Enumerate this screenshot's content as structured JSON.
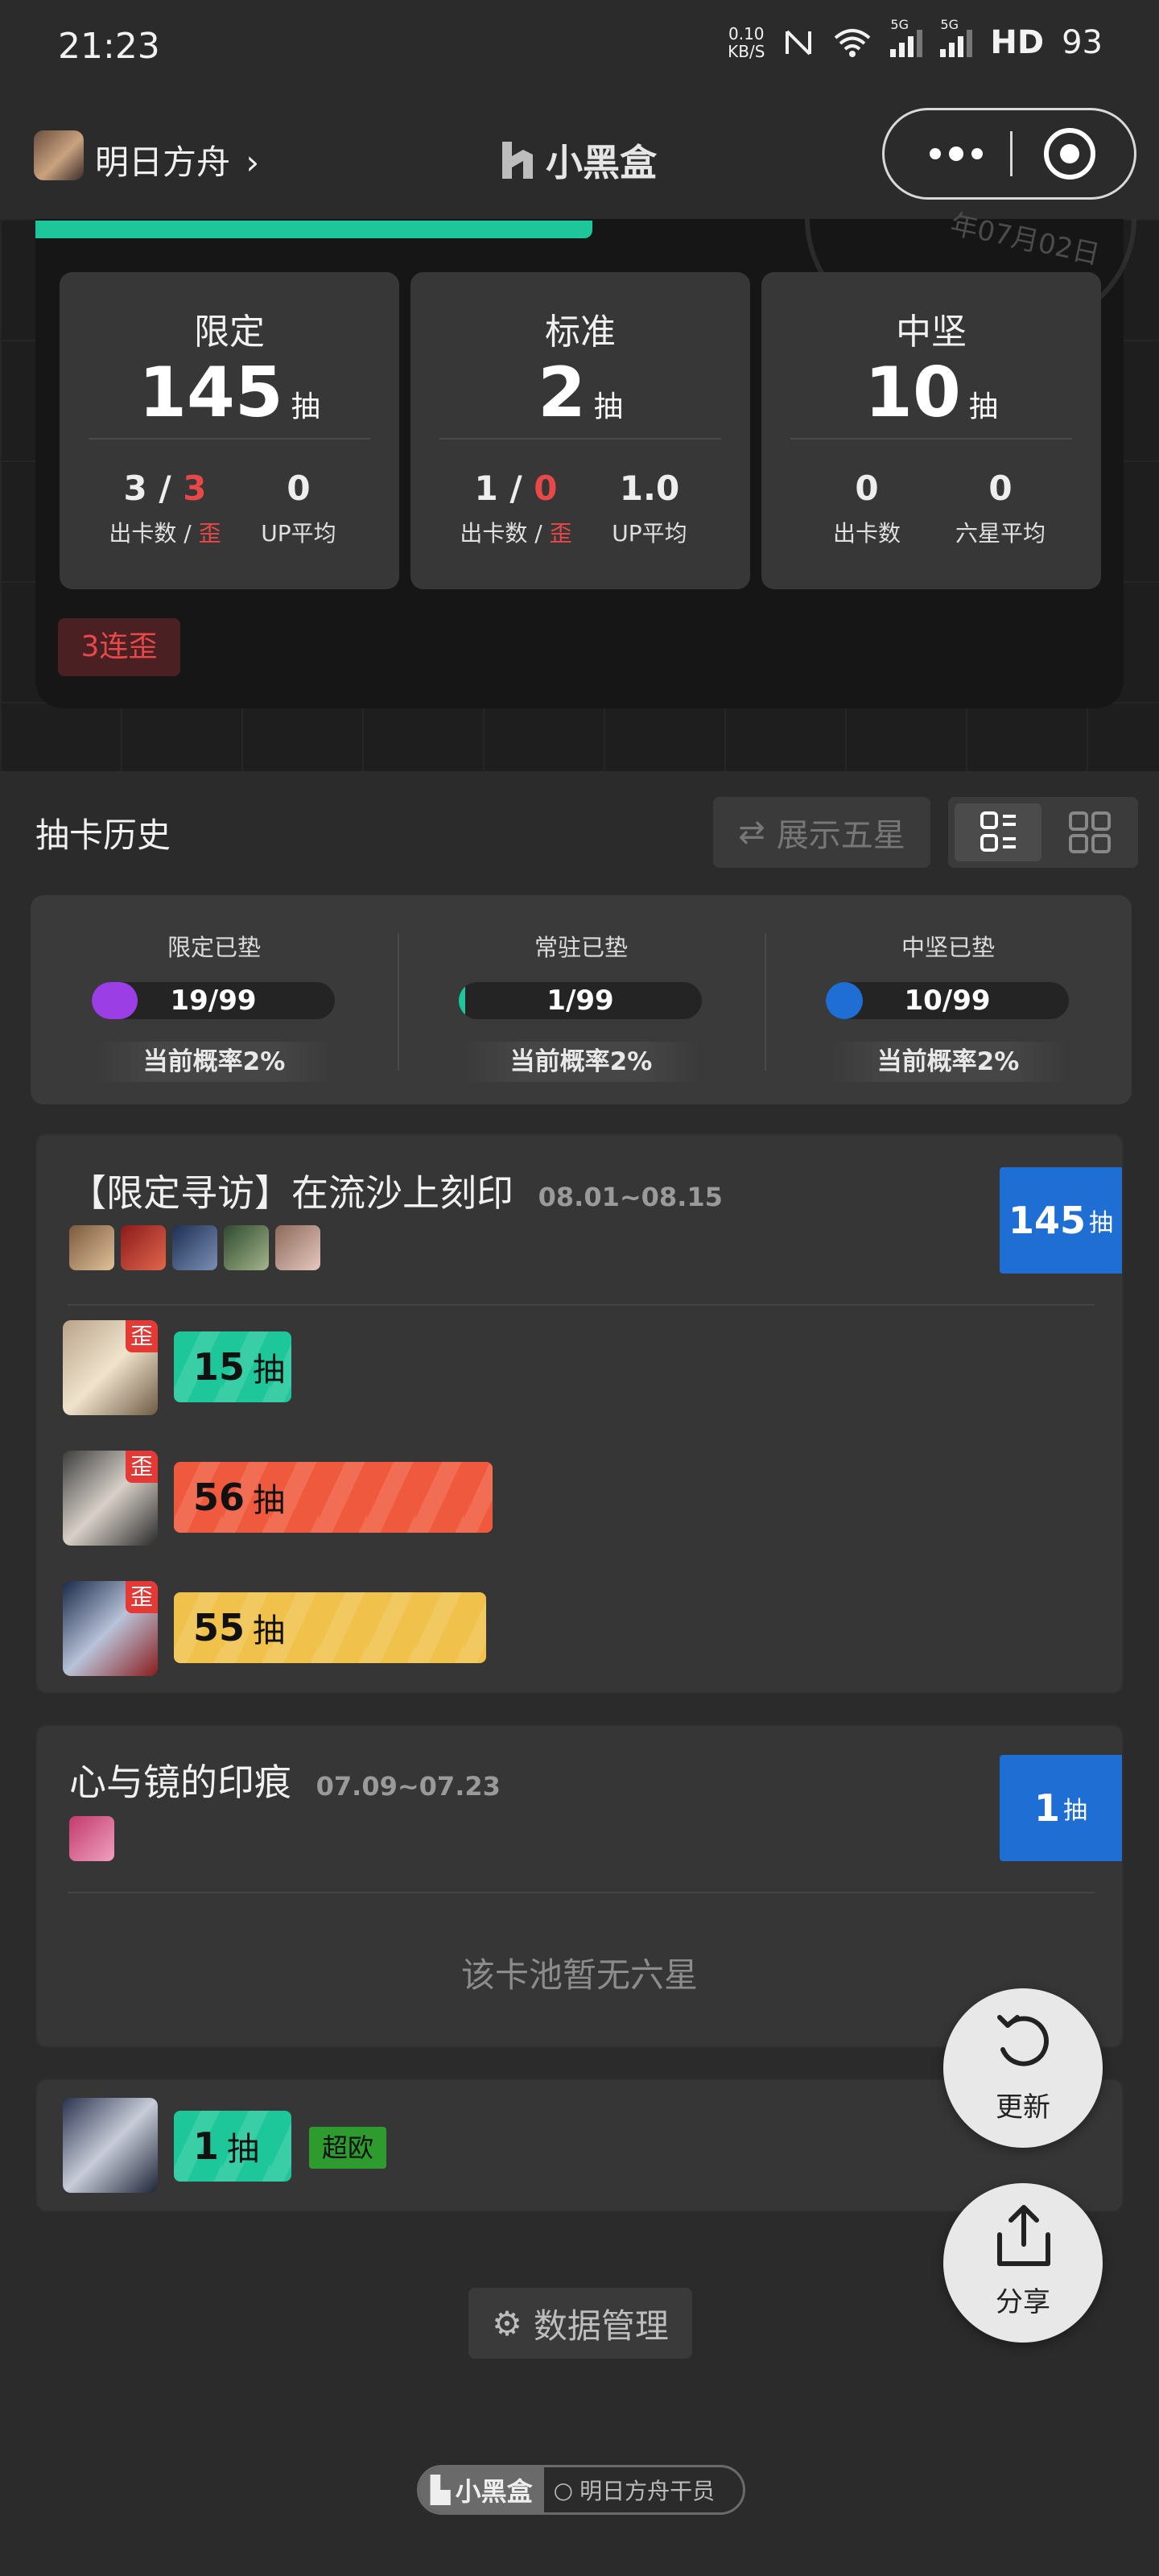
{
  "status_bar": {
    "time": "21:23",
    "net_speed_value": "0.10",
    "net_speed_unit": "KB/S",
    "network_labels": [
      "5G",
      "5G"
    ],
    "hd_label": "HD",
    "battery": "93"
  },
  "header": {
    "game_name": "明日方舟",
    "brand": "小黑盒"
  },
  "summary": {
    "stamp_text": "年07月02日",
    "pools": [
      {
        "name": "限定",
        "count": "145",
        "unit": "抽",
        "stats": [
          {
            "value": "3",
            "value2": "3",
            "label": "出卡数",
            "label2": "歪"
          },
          {
            "value": "0",
            "label": "UP平均"
          }
        ]
      },
      {
        "name": "标准",
        "count": "2",
        "unit": "抽",
        "stats": [
          {
            "value": "1",
            "value2": "0",
            "label": "出卡数",
            "label2": "歪"
          },
          {
            "value": "1.0",
            "label": "UP平均"
          }
        ]
      },
      {
        "name": "中坚",
        "count": "10",
        "unit": "抽",
        "stats": [
          {
            "value": "0",
            "label": "出卡数"
          },
          {
            "value": "0",
            "label": "六星平均"
          }
        ]
      }
    ],
    "streak_tag": "3连歪"
  },
  "history": {
    "title": "抽卡历史",
    "show_five_star": "展示五星",
    "pity": [
      {
        "label": "限定已垫",
        "value": "19/99",
        "fraction": 0.19,
        "color": "#9b3ee6",
        "rate": "当前概率2%"
      },
      {
        "label": "常驻已垫",
        "value": "1/99",
        "fraction": 0.01,
        "color": "#1ec79a",
        "rate": "当前概率2%"
      },
      {
        "label": "中坚已垫",
        "value": "10/99",
        "fraction": 0.1,
        "color": "#1f6ed4",
        "rate": "当前概率2%"
      }
    ]
  },
  "banners": [
    {
      "title": "【限定寻访】在流沙上刻印",
      "dates": "08.01~08.15",
      "pulls": "145",
      "unit": "抽",
      "results": [
        {
          "pulls": "15",
          "unit": "抽",
          "tag": "歪",
          "fraction": 0.15,
          "color": "#1ec79a"
        },
        {
          "pulls": "56",
          "unit": "抽",
          "tag": "歪",
          "fraction": 0.56,
          "color": "#ef5a3e"
        },
        {
          "pulls": "55",
          "unit": "抽",
          "tag": "歪",
          "fraction": 0.55,
          "color": "#f0c14b"
        }
      ]
    },
    {
      "title": "心与镜的印痕",
      "dates": "07.09~07.23",
      "pulls": "1",
      "unit": "抽",
      "empty_note": "该卡池暂无六星"
    }
  ],
  "extra_result": {
    "pulls": "1",
    "unit": "抽",
    "tag": "超欧",
    "fraction": 0.01,
    "color": "#1ec79a"
  },
  "fabs": {
    "refresh": "更新",
    "share": "分享"
  },
  "data_manage": "数据管理",
  "footer": {
    "brand": "小黑盒",
    "search": "明日方舟干员"
  }
}
